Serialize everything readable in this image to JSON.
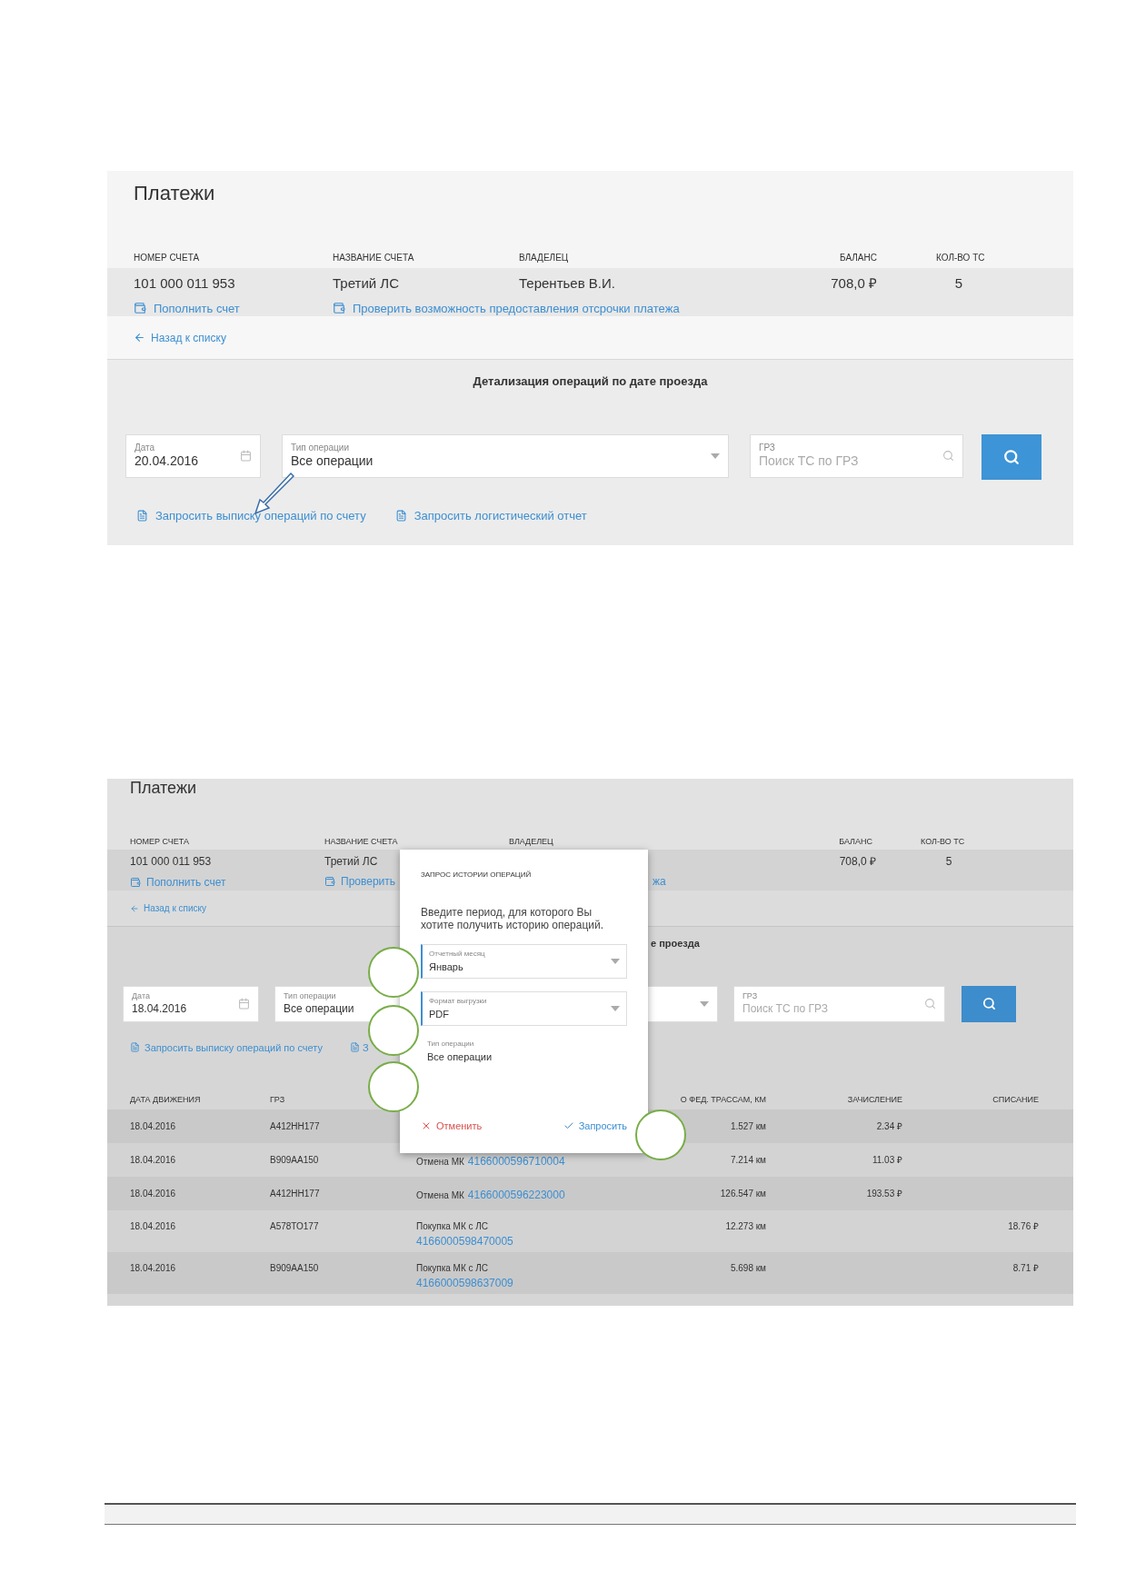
{
  "screenshot_1": {
    "title": "Платежи",
    "account_columns": [
      {
        "label": "НОМЕР СЧЕТА",
        "value": "101 000 011 953"
      },
      {
        "label": "НАЗВАНИЕ СЧЕТА",
        "value": "Третий ЛС"
      },
      {
        "label": "ВЛАДЕЛЕЦ",
        "value": "Терентьев В.И."
      },
      {
        "label": "БАЛАНС",
        "value": "708,0 ₽"
      },
      {
        "label": "КОЛ-ВО ТС",
        "value": "5"
      }
    ],
    "account_actions": [
      "Пополнить счет",
      "Проверить возможность предоставления отсрочки платежа"
    ],
    "back_link": "Назад к списку",
    "section_title": "Детализация операций по дате проезда",
    "date_field": {
      "label": "Дата",
      "value": "20.04.2016"
    },
    "operation_field": {
      "label": "Тип операции",
      "value": "Все операции"
    },
    "plate_field": {
      "label": "ГРЗ",
      "placeholder": "Поиск ТС по ГРЗ"
    },
    "request_links": [
      "Запросить выписку операций по счету",
      "Запросить логистический отчет"
    ]
  },
  "screenshot_2": {
    "title": "Платежи",
    "account_columns": [
      {
        "label": "НОМЕР СЧЕТА",
        "value": "101 000 011 953"
      },
      {
        "label": "НАЗВАНИЕ СЧЕТА",
        "value": "Третий ЛС"
      },
      {
        "label": "ВЛАДЕЛЕЦ"
      },
      {
        "label": "БАЛАНС",
        "value": "708,0 ₽"
      },
      {
        "label": "КОЛ-ВО ТС",
        "value": "5"
      }
    ],
    "account_actions": [
      {
        "text": "Пополнить счет"
      },
      {
        "text": "Проверить",
        "tail": "жа"
      }
    ],
    "back_link": "Назад к списку",
    "section_title_tail": "е проезда",
    "date_field": {
      "label": "Дата",
      "value": "18.04.2016"
    },
    "operation_field": {
      "label": "Тип операции",
      "value": "Все операции"
    },
    "plate_field": {
      "label": "ГРЗ",
      "placeholder": "Поиск ТС по ГРЗ"
    },
    "request_links": [
      "Запросить выписку операций по счету",
      "З"
    ],
    "table": {
      "columns": [
        "ДАТА ДВИЖЕНИЯ",
        "ГРЗ",
        "О ФЕД. ТРАССАМ, КМ",
        "ЗАЧИСЛЕНИЕ",
        "СПИСАНИЕ"
      ],
      "rows": [
        {
          "date": "18.04.2016",
          "plate": "А412НН177",
          "distance": "1.527 км",
          "credit": "2.34 ₽"
        },
        {
          "date": "18.04.2016",
          "plate": "В909АА150",
          "operation": "Отмена МК",
          "card": "4166000596710004",
          "distance": "7.214 км",
          "credit": "11.03 ₽"
        },
        {
          "date": "18.04.2016",
          "plate": "А412НН177",
          "operation": "Отмена МК",
          "card": "4166000596223000",
          "distance": "126.547 км",
          "credit": "193.53 ₽"
        },
        {
          "date": "18.04.2016",
          "plate": "А578ТО177",
          "operation": "Покупка МК с ЛС",
          "card": "4166000598470005",
          "distance": "12.273 км",
          "debit": "18.76 ₽"
        },
        {
          "date": "18.04.2016",
          "plate": "В909АА150",
          "operation": "Покупка МК с ЛС",
          "card": "4166000598637009",
          "distance": "5.698 км",
          "debit": "8.71 ₽"
        }
      ]
    },
    "modal": {
      "title": "ЗАПРОС ИСТОРИИ ОПЕРАЦИЙ",
      "text": "Введите период, для которого Вы хотите получить историю операций.",
      "fields": [
        {
          "kind": "select",
          "label": "Отчетный месяц",
          "value": "Январь"
        },
        {
          "kind": "select",
          "label": "Формат выгрузки",
          "value": "PDF"
        },
        {
          "kind": "static",
          "label": "Тип операции",
          "value": "Все операции"
        }
      ],
      "cancel": "Отменить",
      "submit": "Запросить"
    }
  }
}
